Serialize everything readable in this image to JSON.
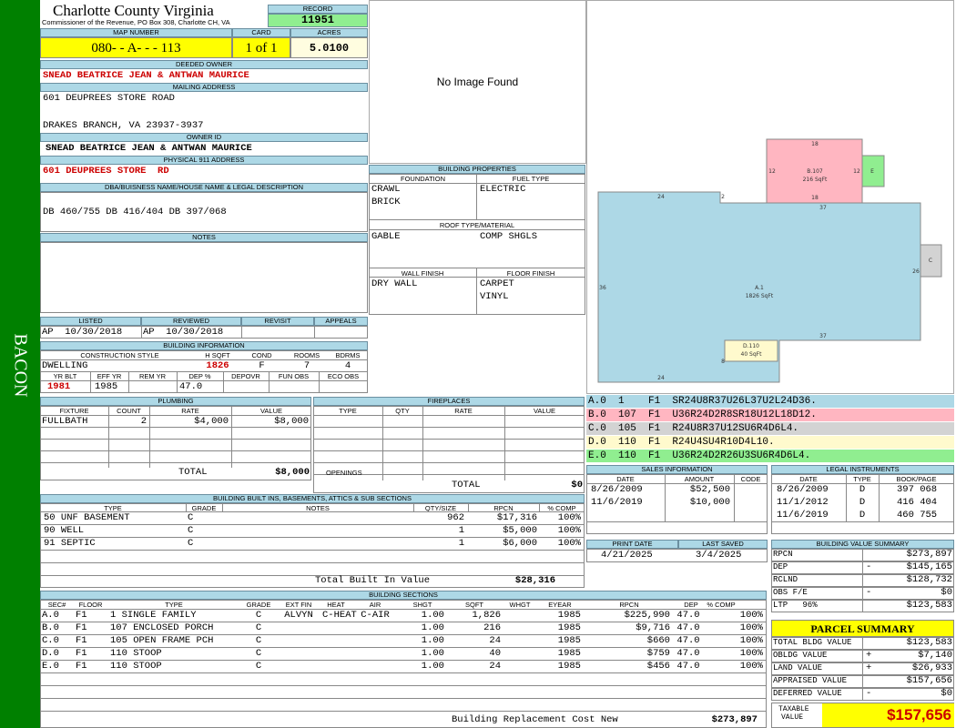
{
  "side_label": "BACON",
  "header": {
    "county": "Charlotte County Virginia",
    "commissioner": "Commissioner of the Revenue, PO Box 308, Charlotte CH, VA",
    "record_label": "RECORD",
    "record": "11951"
  },
  "parcel": {
    "map_label": "MAP NUMBER",
    "map_number": "080- - A- - - 113",
    "card_label": "CARD",
    "card": "1 of 1",
    "acres_label": "ACRES",
    "acres": "5.0100"
  },
  "owner": {
    "deeded_label": "DEEDED OWNER",
    "deeded": "SNEAD BEATRICE JEAN & ANTWAN MAURICE",
    "mailing_label": "MAILING ADDRESS",
    "mail1": "601 DEUPREES STORE ROAD",
    "mail2": "DRAKES BRANCH, VA 23937-3937",
    "owner_id_label": "OWNER ID",
    "owner_id": "SNEAD BEATRICE JEAN & ANTWAN MAURICE",
    "phys_label": "PHYSICAL 911 ADDRESS",
    "phys": "601 DEUPREES STORE  RD",
    "dba_label": "DBA/BUISNESS NAME/HOUSE NAME & LEGAL DESCRIPTION",
    "legal": "DB 460/755 DB 416/404 DB 397/068",
    "notes_label": "NOTES"
  },
  "photo": {
    "text": "No Image Found"
  },
  "dates": {
    "listed_label": "LISTED",
    "listed": "AP  10/30/2018",
    "reviewed_label": "REVIEWED",
    "reviewed": "AP  10/30/2018",
    "revisit_label": "REVISIT",
    "appeals_label": "APPEALS"
  },
  "building_info": {
    "title": "BUILDING INFORMATION",
    "h_style": "CONSTRUCTION STYLE",
    "h_sqft": "H SQFT",
    "h_cond": "COND",
    "h_rooms": "ROOMS",
    "h_bdrms": "BDRMS",
    "style": "DWELLING",
    "sqft": "1826",
    "cond": "F",
    "rooms": "7",
    "bdrms": "4",
    "h_yrblt": "YR BLT",
    "h_effyr": "EFF YR",
    "h_remyr": "REM YR",
    "h_dep": "DEP %",
    "h_depovr": "DEPOVR",
    "h_funobs": "FUN OBS",
    "h_ecoobs": "ECO OBS",
    "yrblt": "1981",
    "effyr": "1985",
    "dep": "47.0"
  },
  "props": {
    "title": "BUILDING PROPERTIES",
    "foundation_label": "FOUNDATION",
    "fuel_label": "FUEL TYPE",
    "foundation1": "CRAWL",
    "foundation2": "BRICK",
    "fuel": "ELECTRIC",
    "roof_label": "ROOF TYPE/MATERIAL",
    "roof1": "GABLE",
    "roof2": "COMP SHGLS",
    "wall_label": "WALL FINISH",
    "floor_label": "FLOOR FINISH",
    "wall": "DRY WALL",
    "floor1": "CARPET",
    "floor2": "VINYL"
  },
  "sketch": {
    "main": {
      "name": "A.1",
      "sqft": "1826 SqFt"
    },
    "porch": {
      "name": "B.107",
      "sqft": "216 SqFt"
    },
    "stoop": {
      "name": "D.110",
      "sqft": "40 SqFt"
    },
    "e": "E",
    "c": "C",
    "dims": [
      "18",
      "12",
      "12",
      "18",
      "37",
      "24",
      "2",
      "36",
      "26",
      "37",
      "24",
      "8"
    ]
  },
  "codes": [
    {
      "text": "A.0  1    F1  SR24U8R37U26L37U2L24D36.",
      "color": "#add8e6"
    },
    {
      "text": "B.0  107  F1  U36R24D2R8SR18U12L18D12.",
      "color": "#ffb6c1"
    },
    {
      "text": "C.0  105  F1  R24U8R37U12SU6R4D6L4.",
      "color": "#d3d3d3"
    },
    {
      "text": "D.0  110  F1  R24U4SU4R10D4L10.",
      "color": "#fffacd"
    },
    {
      "text": "E.0  110  F1  U36R24D2R26U3SU6R4D6L4.",
      "color": "#90ee90"
    }
  ],
  "plumbing": {
    "title": "PLUMBING",
    "h": [
      "FIXTURE",
      "COUNT",
      "RATE",
      "VALUE"
    ],
    "rows": [
      [
        "FULLBATH",
        "2",
        "$4,000",
        "$8,000"
      ]
    ],
    "total_label": "TOTAL",
    "total": "$8,000"
  },
  "fireplaces": {
    "title": "FIREPLACES",
    "h": [
      "TYPE",
      "QTY",
      "RATE",
      "VALUE"
    ],
    "openings_label": "OPENINGS",
    "total_label": "TOTAL",
    "total": "$0"
  },
  "sales": {
    "title": "SALES INFORMATION",
    "h": [
      "DATE",
      "AMOUNT",
      "CODE"
    ],
    "rows": [
      [
        "8/26/2009",
        "$52,500",
        ""
      ],
      [
        "11/6/2019",
        "$10,000",
        ""
      ]
    ]
  },
  "legal": {
    "title": "LEGAL INSTRUMENTS",
    "h": [
      "DATE",
      "TYPE",
      "BOOK/PAGE"
    ],
    "rows": [
      [
        "8/26/2009",
        "D",
        "397 068"
      ],
      [
        "11/1/2012",
        "D",
        "416 404"
      ],
      [
        "11/6/2019",
        "D",
        "460 755"
      ]
    ]
  },
  "print": {
    "print_label": "PRINT DATE",
    "print_date": "4/21/2025",
    "saved_label": "LAST SAVED",
    "saved": "3/4/2025"
  },
  "builtins": {
    "title": "BUILDING BUILT INS, BASEMENTS, ATTICS & SUB SECTIONS",
    "h": [
      "TYPE",
      "GRADE",
      "NOTES",
      "QTY/SIZE",
      "RPCN",
      "% COMP"
    ],
    "rows": [
      [
        "50 UNF BASEMENT",
        "C",
        "",
        "962",
        "$17,316",
        "100%"
      ],
      [
        "90 WELL",
        "C",
        "",
        "1",
        "$5,000",
        "100%"
      ],
      [
        "91 SEPTIC",
        "C",
        "",
        "1",
        "$6,000",
        "100%"
      ]
    ],
    "total_label": "Total Built In Value",
    "total": "$28,316"
  },
  "sections": {
    "title": "BUILDING SECTIONS",
    "h": [
      "SEC#",
      "FLOOR",
      "TYPE",
      "GRADE",
      "EXT FIN",
      "HEAT",
      "AIR",
      "SHGT",
      "SQFT",
      "WHGT",
      "EYEAR",
      "RPCN",
      "DEP",
      "% COMP"
    ],
    "rows": [
      [
        "A.0",
        "F1",
        "1 SINGLE FAMILY",
        "C",
        "ALVYN",
        "C-HEAT",
        "C-AIR",
        "1.00",
        "1,826",
        "",
        "1985",
        "$225,990",
        "47.0",
        "100%"
      ],
      [
        "B.0",
        "F1",
        "107 ENCLOSED PORCH",
        "C",
        "",
        "",
        "",
        "1.00",
        "216",
        "",
        "1985",
        "$9,716",
        "47.0",
        "100%"
      ],
      [
        "C.0",
        "F1",
        "105 OPEN FRAME PCH",
        "C",
        "",
        "",
        "",
        "1.00",
        "24",
        "",
        "1985",
        "$660",
        "47.0",
        "100%"
      ],
      [
        "D.0",
        "F1",
        "110 STOOP",
        "C",
        "",
        "",
        "",
        "1.00",
        "40",
        "",
        "1985",
        "$759",
        "47.0",
        "100%"
      ],
      [
        "E.0",
        "F1",
        "110 STOOP",
        "C",
        "",
        "",
        "",
        "1.00",
        "24",
        "",
        "1985",
        "$456",
        "47.0",
        "100%"
      ]
    ],
    "total_label": "Building Replacement Cost New",
    "total": "$273,897"
  },
  "value_summary": {
    "title": "BUILDING VALUE SUMMARY",
    "rows": [
      [
        "RPCN",
        "",
        "$273,897"
      ],
      [
        "DEP",
        "-",
        "$145,165"
      ],
      [
        "RCLND",
        "",
        "$128,732"
      ],
      [
        "OBS F/E",
        "-",
        "$0"
      ],
      [
        "LTP   96%",
        "",
        "$123,583"
      ]
    ]
  },
  "parcel_summary": {
    "title": "PARCEL SUMMARY",
    "rows": [
      [
        "TOTAL BLDG VALUE",
        "",
        "$123,583"
      ],
      [
        "OBLDG VALUE",
        "+",
        "$7,140"
      ],
      [
        "LAND VALUE",
        "+",
        "$26,933"
      ],
      [
        "APPRAISED VALUE",
        "",
        "$157,656"
      ],
      [
        "DEFERRED VALUE",
        "-",
        "$0"
      ]
    ],
    "taxable_label1": "TAXABLE",
    "taxable_label2": "VALUE",
    "taxable": "$157,656"
  },
  "colors": {
    "side": "#008000",
    "label": "#add8e6",
    "yellow": "#ffff00",
    "record": "#90ee90",
    "red": "#cc0000"
  }
}
